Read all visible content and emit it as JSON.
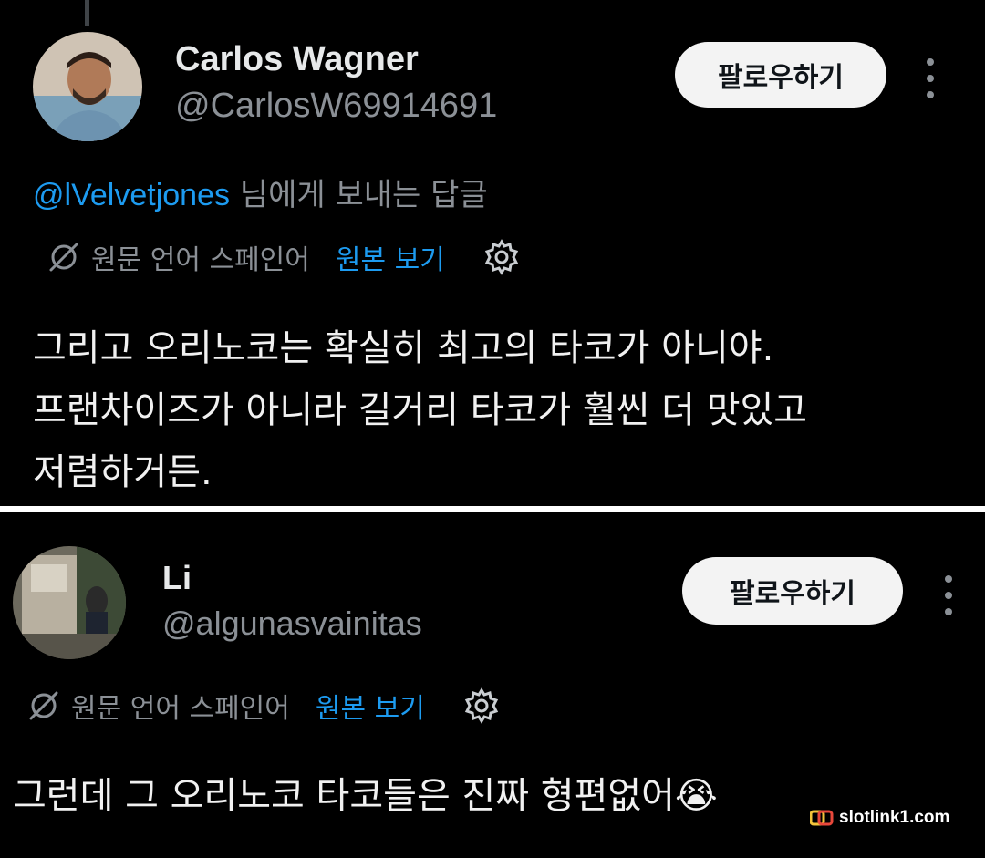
{
  "posts": [
    {
      "author_name": "Carlos Wagner",
      "handle": "@CarlosW69914691",
      "follow_label": "팔로우하기",
      "reply_to_mention": "@lVelvetjones",
      "reply_to_suffix": " 님에게 보내는 답글",
      "translation_lang": "원문 언어 스페인어",
      "translation_original": "원본 보기",
      "text_lines": [
        "그리고 오리노코는 확실히 최고의 타코가 아니야.",
        "프랜차이즈가 아니라 길거리 타코가 훨씬 더 맛있고",
        "저렴하거든."
      ],
      "icons": [
        "translate-icon",
        "gear-icon",
        "more-icon"
      ]
    },
    {
      "author_name": "Li",
      "handle": "@algunasvainitas",
      "follow_label": "팔로우하기",
      "translation_lang": "원문 언어 스페인어",
      "translation_original": "원본 보기",
      "text": "그런데 그 오리노코 타코들은 진짜 형편없어",
      "emoji": "😭",
      "icons": [
        "translate-icon",
        "gear-icon",
        "more-icon"
      ]
    }
  ],
  "watermark": "slotlink1.com",
  "colors": {
    "background": "#000000",
    "link_blue": "#1d9bf0",
    "muted_gray": "#8b9096",
    "follow_button_bg": "#f3f3f3"
  }
}
